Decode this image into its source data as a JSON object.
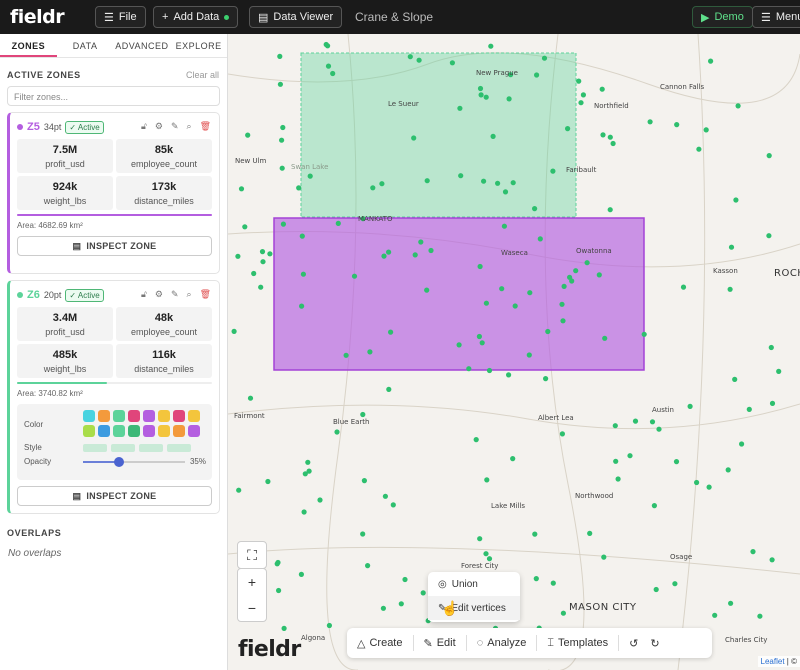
{
  "topbar": {
    "logo": "fieldr",
    "file": "File",
    "add_data": "Add Data",
    "data_viewer": "Data Viewer",
    "project": "Crane & Slope",
    "demo": "Demo",
    "menu": "Menu"
  },
  "sidebar": {
    "tabs": [
      "ZONES",
      "DATA",
      "ADVANCED",
      "EXPLORE"
    ],
    "active_zones_label": "ACTIVE ZONES",
    "clear_all": "Clear all",
    "filter_placeholder": "Filter zones...",
    "zones": [
      {
        "id": "Z5",
        "size": "34pt",
        "status": "✓ Active",
        "color": "#b45ee0",
        "metrics": [
          {
            "value": "7.5M",
            "label": "profit_usd"
          },
          {
            "value": "85k",
            "label": "employee_count"
          },
          {
            "value": "924k",
            "label": "weight_lbs"
          },
          {
            "value": "173k",
            "label": "distance_miles"
          }
        ],
        "progress": 1.0,
        "area": "Area: 4682.69 km²",
        "inspect": "INSPECT ZONE"
      },
      {
        "id": "Z6",
        "size": "20pt",
        "status": "✓ Active",
        "color": "#5cd39a",
        "metrics": [
          {
            "value": "3.4M",
            "label": "profit_usd"
          },
          {
            "value": "48k",
            "label": "employee_count"
          },
          {
            "value": "485k",
            "label": "weight_lbs"
          },
          {
            "value": "116k",
            "label": "distance_miles"
          }
        ],
        "progress": 0.46,
        "area": "Area: 3740.82 km²",
        "style": {
          "color_label": "Color",
          "style_label": "Style",
          "opacity_label": "Opacity",
          "opacity": "35%",
          "opacity_value": 0.35,
          "swatches": [
            "#49d3e0",
            "#f39a3c",
            "#5cd39a",
            "#e0457b",
            "#b45ee0",
            "#f3c53c",
            "#e0457b",
            "#f3c53c",
            "#a9dd4a",
            "#3c9be0",
            "#5cd39a",
            "#3cb878",
            "#b45ee0",
            "#f3c53c",
            "#f39a3c",
            "#b45ee0"
          ]
        },
        "inspect": "INSPECT ZONE"
      }
    ],
    "overlaps_label": "OVERLAPS",
    "no_overlaps": "No overlaps"
  },
  "map": {
    "cities": [
      {
        "name": "New Prague",
        "big": false
      },
      {
        "name": "Le Sueur",
        "big": false
      },
      {
        "name": "Cannon Falls",
        "big": false
      },
      {
        "name": "Northfield",
        "big": false
      },
      {
        "name": "New Ulm",
        "big": false
      },
      {
        "name": "Faribault",
        "big": false
      },
      {
        "name": "MANKATO",
        "big": false
      },
      {
        "name": "Waseca",
        "big": false
      },
      {
        "name": "Owatonna",
        "big": false
      },
      {
        "name": "Kasson",
        "big": false
      },
      {
        "name": "ROCH",
        "big": true
      },
      {
        "name": "Austin",
        "big": false
      },
      {
        "name": "Fairmont",
        "big": false
      },
      {
        "name": "Blue Earth",
        "big": false
      },
      {
        "name": "Albert Lea",
        "big": false
      },
      {
        "name": "Northwood",
        "big": false
      },
      {
        "name": "Lake Mills",
        "big": false
      },
      {
        "name": "Forest City",
        "big": false
      },
      {
        "name": "Osage",
        "big": false
      },
      {
        "name": "MASON CITY",
        "big": true
      },
      {
        "name": "Algona",
        "big": false
      },
      {
        "name": "Charles City",
        "big": false
      },
      {
        "name": "Swan Lake",
        "big": false
      }
    ],
    "popup": {
      "union": "Union",
      "edit_vertices": "Edit vertices"
    },
    "toolbar": {
      "create": "Create",
      "edit": "Edit",
      "analyze": "Analyze",
      "templates": "Templates"
    },
    "logo": "fieldr",
    "attribution_leaflet": "Leaflet",
    "attribution_rest": "| ©"
  }
}
